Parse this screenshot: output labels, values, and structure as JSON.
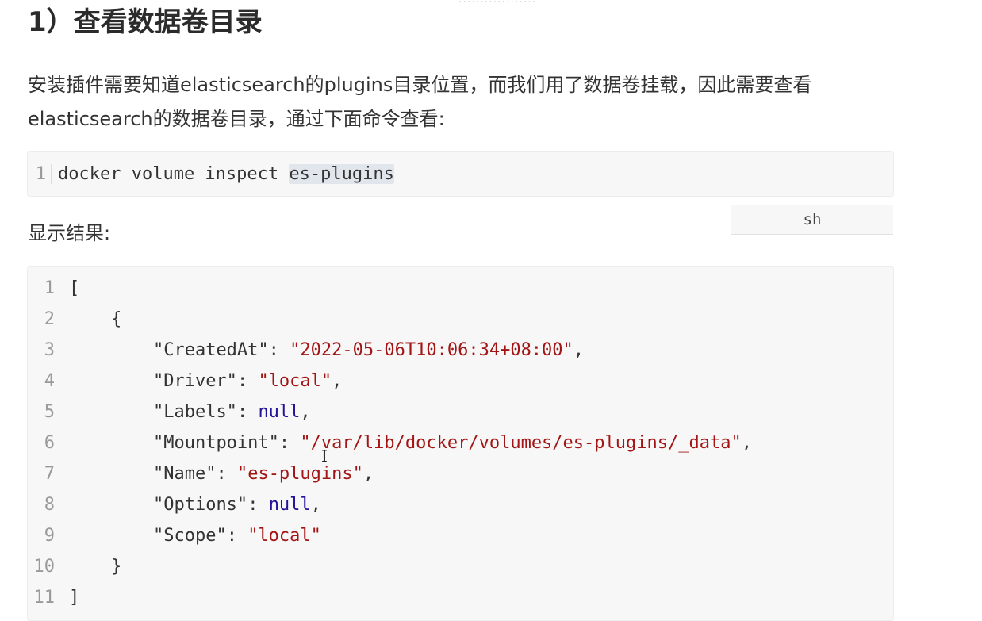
{
  "header": {
    "fragment": "..................",
    "title": "1）查看数据卷目录"
  },
  "intro": {
    "text": "安装插件需要知道elasticsearch的plugins目录位置，而我们用了数据卷挂载，因此需要查看elasticsearch的数据卷目录，通过下面命令查看:"
  },
  "command_block": {
    "line_number": "1",
    "command": "docker volume inspect ",
    "highlighted": "es-plugins",
    "language": "sh"
  },
  "result_label": "显示结果:",
  "result_block": {
    "lines": [
      {
        "n": "1",
        "indent": "",
        "key": "[",
        "sep": "",
        "value": "",
        "tail": ""
      },
      {
        "n": "2",
        "indent": "    ",
        "key": "{",
        "sep": "",
        "value": "",
        "tail": ""
      },
      {
        "n": "3",
        "indent": "        ",
        "key": "\"CreatedAt\"",
        "sep": ": ",
        "value": "\"2022-05-06T10:06:34+08:00\"",
        "tail": ","
      },
      {
        "n": "4",
        "indent": "        ",
        "key": "\"Driver\"",
        "sep": ": ",
        "value": "\"local\"",
        "tail": ","
      },
      {
        "n": "5",
        "indent": "        ",
        "key": "\"Labels\"",
        "sep": ": ",
        "value": "null",
        "tail": ","
      },
      {
        "n": "6",
        "indent": "        ",
        "key": "\"Mountpoint\"",
        "sep": ": ",
        "value": "\"/var/lib/docker/volumes/es-plugins/_data\"",
        "tail": ","
      },
      {
        "n": "7",
        "indent": "        ",
        "key": "\"Name\"",
        "sep": ": ",
        "value": "\"es-plugins\"",
        "tail": ","
      },
      {
        "n": "8",
        "indent": "        ",
        "key": "\"Options\"",
        "sep": ": ",
        "value": "null",
        "tail": ","
      },
      {
        "n": "9",
        "indent": "        ",
        "key": "\"Scope\"",
        "sep": ": ",
        "value": "\"local\"",
        "tail": ""
      },
      {
        "n": "10",
        "indent": "    ",
        "key": "}",
        "sep": "",
        "value": "",
        "tail": ""
      },
      {
        "n": "11",
        "indent": "",
        "key": "]",
        "sep": "",
        "value": "",
        "tail": ""
      }
    ]
  },
  "colors": {
    "string": "#a31515",
    "keyword": "#221199",
    "highlight": "#e1e5ec",
    "code_bg": "#f7f7f7"
  },
  "cursor_icon": "text-cursor-icon"
}
